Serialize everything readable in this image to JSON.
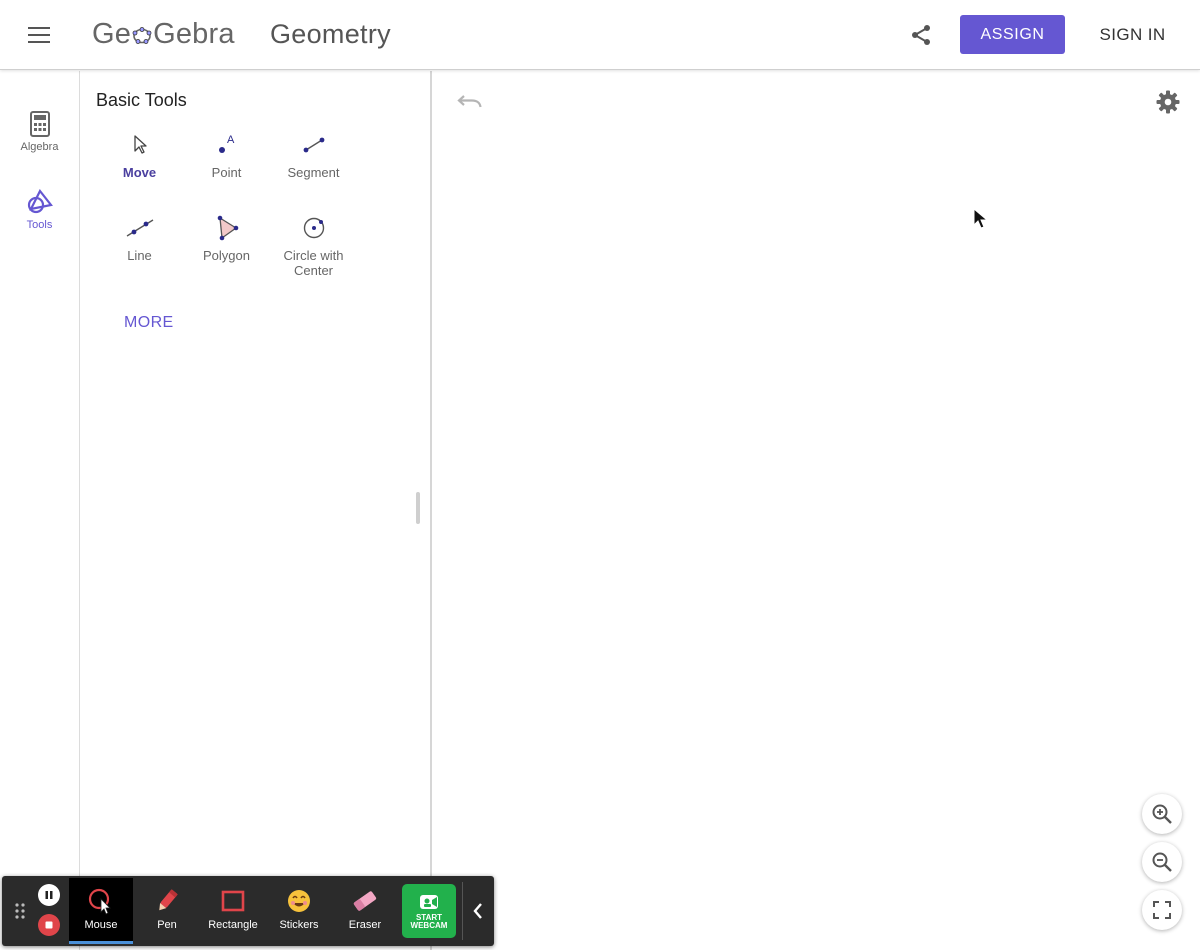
{
  "header": {
    "logo_part1": "Ge",
    "logo_part2": "Gebra",
    "app_title": "Geometry",
    "assign_label": "ASSIGN",
    "signin_label": "SIGN IN",
    "accent_color": "#6557d2"
  },
  "rail": {
    "items": [
      {
        "label": "Algebra",
        "icon": "calculator-icon"
      },
      {
        "label": "Tools",
        "icon": "geometry-shapes-icon"
      }
    ]
  },
  "tools_panel": {
    "title": "Basic Tools",
    "tools": [
      {
        "label": "Move",
        "icon": "move-arrow-icon",
        "selected": true
      },
      {
        "label": "Point",
        "icon": "point-icon"
      },
      {
        "label": "Segment",
        "icon": "segment-icon"
      },
      {
        "label": "Line",
        "icon": "line-icon"
      },
      {
        "label": "Polygon",
        "icon": "polygon-icon"
      },
      {
        "label": "Circle with Center",
        "icon": "circle-center-icon"
      }
    ],
    "point_icon_letter": "A",
    "more_label": "MORE"
  },
  "recorder": {
    "tools": [
      {
        "label": "Mouse",
        "icon": "mouse-pointer-icon",
        "active": true
      },
      {
        "label": "Pen",
        "icon": "pen-icon"
      },
      {
        "label": "Rectangle",
        "icon": "rectangle-icon"
      },
      {
        "label": "Stickers",
        "icon": "sticker-icon"
      },
      {
        "label": "Eraser",
        "icon": "eraser-icon"
      }
    ],
    "webcam_line1": "START",
    "webcam_line2": "WEBCAM",
    "webcam_color": "#22b14c",
    "stop_color": "#e0454a"
  }
}
